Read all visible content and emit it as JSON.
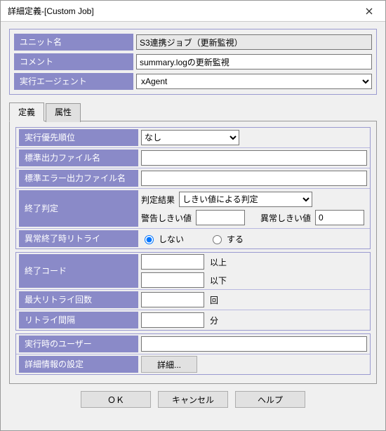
{
  "window": {
    "title": "詳細定義-[Custom Job]"
  },
  "header": {
    "unit_name_label": "ユニット名",
    "unit_name_value": "S3連携ジョブ（更新監視）",
    "comment_label": "コメント",
    "comment_value": "summary.logの更新監視",
    "agent_label": "実行エージェント",
    "agent_value": "xAgent"
  },
  "tabs": {
    "definition": "定義",
    "attributes": "属性"
  },
  "definition": {
    "priority_label": "実行優先順位",
    "priority_value": "なし",
    "stdout_file_label": "標準出力ファイル名",
    "stdout_file_value": "",
    "stderr_file_label": "標準エラー出力ファイル名",
    "stderr_file_value": "",
    "end_judgement_label": "終了判定",
    "judgement_result_label": "判定結果",
    "judgement_result_value": "しきい値による判定",
    "warn_threshold_label": "警告しきい値",
    "warn_threshold_value": "",
    "error_threshold_label": "異常しきい値",
    "error_threshold_value": "0",
    "retry_on_abend_label": "異常終了時リトライ",
    "retry_no": "しない",
    "retry_yes": "する",
    "end_code_label": "終了コード",
    "end_code_ge_value": "",
    "end_code_le_value": "",
    "ge_text": "以上",
    "le_text": "以下",
    "max_retry_label": "最大リトライ回数",
    "max_retry_value": "",
    "retry_unit": "回",
    "retry_interval_label": "リトライ間隔",
    "retry_interval_value": "",
    "interval_unit": "分",
    "exec_user_label": "実行時のユーザー",
    "exec_user_value": "",
    "detail_settings_label": "詳細情報の設定",
    "detail_button": "詳細..."
  },
  "buttons": {
    "ok": "ＯＫ",
    "cancel": "キャンセル",
    "help": "ヘルプ"
  }
}
